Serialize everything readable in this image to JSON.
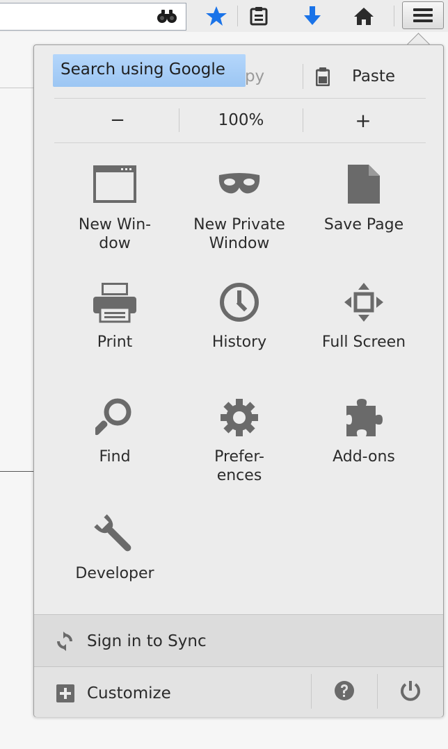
{
  "toolbar": {
    "icons": [
      "binoculars-icon",
      "bookmark-star-icon",
      "reading-list-icon",
      "download-arrow-icon",
      "home-icon",
      "hamburger-menu-icon"
    ]
  },
  "tooltip": {
    "text": "Search using Google"
  },
  "edit_row": {
    "copy_label": "Copy",
    "paste_label": "Paste"
  },
  "zoom_row": {
    "minus": "−",
    "level": "100%",
    "plus": "+"
  },
  "tiles": {
    "new_window": "New Win-\ndow",
    "new_private_window": "New Private\nWindow",
    "save_page": "Save Page",
    "print": "Print",
    "history": "History",
    "full_screen": "Full Screen",
    "find": "Find",
    "preferences": "Prefer-\nences",
    "addons": "Add-ons",
    "developer": "Developer"
  },
  "sync": {
    "label": "Sign in to Sync"
  },
  "footer": {
    "customize_label": "Customize"
  },
  "colors": {
    "accent_blue": "#1a73e8",
    "icon_gray": "#6a6a6a",
    "tooltip_blue": "#a8cff8"
  }
}
